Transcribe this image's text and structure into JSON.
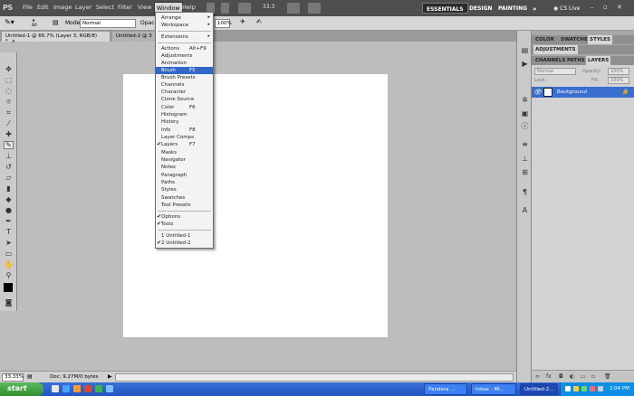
{
  "menubar": {
    "logo": "PS",
    "items": [
      "File",
      "Edit",
      "Image",
      "Layer",
      "Select",
      "Filter",
      "View",
      "Window",
      "Help"
    ],
    "zoom_value": "33.3",
    "workspaces": [
      "ESSENTIALS",
      "DESIGN",
      "PAINTING"
    ],
    "more": "»",
    "cslive": "CS Live"
  },
  "options": {
    "brush_size": "80",
    "mode_label": "Mode:",
    "mode_value": "Normal",
    "opacity_label": "Opaci",
    "flow_value": "100%"
  },
  "tabs": [
    {
      "label": "Untitled-1 @ 66.7% (Layer 3, RGB/8) *",
      "close": "×"
    },
    {
      "label": "Untitled-2 @ 3",
      "close": ""
    }
  ],
  "window_menu": {
    "items": [
      {
        "label": "Arrange",
        "arrow": "▸"
      },
      {
        "label": "Workspace",
        "arrow": "▸"
      },
      {
        "label": "Extensions",
        "arrow": "▸"
      },
      {
        "label": "Actions",
        "shortcut": "Alt+F9"
      },
      {
        "label": "Adjustments"
      },
      {
        "label": "Animation"
      },
      {
        "label": "Brush",
        "shortcut": "F5"
      },
      {
        "label": "Brush Presets"
      },
      {
        "label": "Channels"
      },
      {
        "label": "Character"
      },
      {
        "label": "Clone Source"
      },
      {
        "label": "Color",
        "shortcut": "F6"
      },
      {
        "label": "Histogram"
      },
      {
        "label": "History"
      },
      {
        "label": "Info",
        "shortcut": "F8"
      },
      {
        "label": "Layer Comps"
      },
      {
        "label": "Layers",
        "shortcut": "F7",
        "check": "✔"
      },
      {
        "label": "Masks"
      },
      {
        "label": "Navigator"
      },
      {
        "label": "Notes"
      },
      {
        "label": "Paragraph"
      },
      {
        "label": "Paths"
      },
      {
        "label": "Styles"
      },
      {
        "label": "Swatches"
      },
      {
        "label": "Tool Presets"
      },
      {
        "label": "Options",
        "check": "✔"
      },
      {
        "label": "Tools",
        "check": "✔"
      },
      {
        "label": "1 Untitled-1"
      },
      {
        "label": "2 Untitled-2",
        "check": "✔"
      }
    ]
  },
  "panels": {
    "top_tabs": [
      "COLOR",
      "SWATCHES",
      "STYLES"
    ],
    "adjustments_tab": "ADJUSTMENTS",
    "layer_tabs": [
      "CHANNELS",
      "PATHS",
      "LAYERS"
    ],
    "blend_mode": "Normal",
    "opacity_label": "Opacity:",
    "opacity_value": "100%",
    "lock_label": "Lock:",
    "fill_label": "Fill:",
    "fill_value": "100%",
    "layer_name": "Background"
  },
  "status": {
    "zoom": "33.33%",
    "doc": "Doc: 9.27M/0 bytes"
  },
  "taskbar": {
    "start": "start",
    "tasks": [
      "Pandora ...",
      "Inbox - Mi...",
      "Untitled-2..."
    ],
    "clock": "2:04 PM"
  }
}
